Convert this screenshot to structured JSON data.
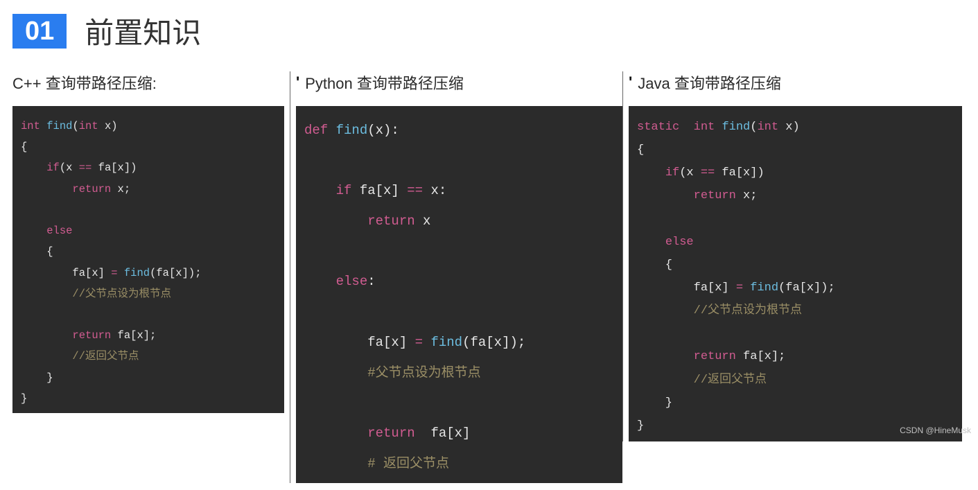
{
  "header": {
    "num": "01",
    "title": "前置知识"
  },
  "columns": [
    {
      "heading": "C++ 查询带路径压缩:",
      "showTick": false,
      "code": [
        {
          "segs": [
            {
              "cls": "c-type",
              "t": "int "
            },
            {
              "cls": "c-fn",
              "t": "find"
            },
            {
              "cls": "c-paren",
              "t": "("
            },
            {
              "cls": "c-type",
              "t": "int"
            },
            {
              "cls": "c-plain",
              "t": " x)"
            }
          ]
        },
        {
          "segs": [
            {
              "cls": "c-plain",
              "t": "{"
            }
          ]
        },
        {
          "segs": [
            {
              "cls": "c-plain",
              "t": "    "
            },
            {
              "cls": "c-kw",
              "t": "if"
            },
            {
              "cls": "c-plain",
              "t": "(x "
            },
            {
              "cls": "c-op",
              "t": "=="
            },
            {
              "cls": "c-plain",
              "t": " fa[x])"
            }
          ]
        },
        {
          "segs": [
            {
              "cls": "c-plain",
              "t": "        "
            },
            {
              "cls": "c-ret",
              "t": "return"
            },
            {
              "cls": "c-plain",
              "t": " x;"
            }
          ]
        },
        {
          "segs": [
            {
              "cls": "c-plain",
              "t": " "
            }
          ]
        },
        {
          "segs": [
            {
              "cls": "c-plain",
              "t": "    "
            },
            {
              "cls": "c-else",
              "t": "else"
            }
          ]
        },
        {
          "segs": [
            {
              "cls": "c-plain",
              "t": "    {"
            }
          ]
        },
        {
          "segs": [
            {
              "cls": "c-plain",
              "t": "        fa[x] "
            },
            {
              "cls": "c-op",
              "t": "="
            },
            {
              "cls": "c-plain",
              "t": " "
            },
            {
              "cls": "c-fn",
              "t": "find"
            },
            {
              "cls": "c-plain",
              "t": "(fa[x]);"
            }
          ]
        },
        {
          "segs": [
            {
              "cls": "c-plain",
              "t": "        "
            },
            {
              "cls": "c-comment",
              "t": "//父节点设为根节点"
            }
          ]
        },
        {
          "segs": [
            {
              "cls": "c-plain",
              "t": " "
            }
          ]
        },
        {
          "segs": [
            {
              "cls": "c-plain",
              "t": "        "
            },
            {
              "cls": "c-ret",
              "t": "return"
            },
            {
              "cls": "c-plain",
              "t": " fa[x];"
            }
          ]
        },
        {
          "segs": [
            {
              "cls": "c-plain",
              "t": "        "
            },
            {
              "cls": "c-comment",
              "t": "//返回父节点"
            }
          ]
        },
        {
          "segs": [
            {
              "cls": "c-plain",
              "t": "    }"
            }
          ]
        },
        {
          "segs": [
            {
              "cls": "c-plain",
              "t": "}"
            }
          ]
        }
      ]
    },
    {
      "heading": "Python 查询带路径压缩",
      "showTick": true,
      "code": [
        {
          "segs": [
            {
              "cls": "c-kw",
              "t": "def "
            },
            {
              "cls": "c-fn",
              "t": "find"
            },
            {
              "cls": "c-plain",
              "t": "(x):"
            }
          ]
        },
        {
          "segs": [
            {
              "cls": "c-plain",
              "t": " "
            }
          ]
        },
        {
          "segs": [
            {
              "cls": "c-plain",
              "t": "    "
            },
            {
              "cls": "c-kw",
              "t": "if"
            },
            {
              "cls": "c-plain",
              "t": " fa[x] "
            },
            {
              "cls": "c-op",
              "t": "=="
            },
            {
              "cls": "c-plain",
              "t": " x:"
            }
          ]
        },
        {
          "segs": [
            {
              "cls": "c-plain",
              "t": "        "
            },
            {
              "cls": "c-ret",
              "t": "return"
            },
            {
              "cls": "c-plain",
              "t": " x"
            }
          ]
        },
        {
          "segs": [
            {
              "cls": "c-plain",
              "t": " "
            }
          ]
        },
        {
          "segs": [
            {
              "cls": "c-plain",
              "t": "    "
            },
            {
              "cls": "c-else",
              "t": "else"
            },
            {
              "cls": "c-plain",
              "t": ":"
            }
          ]
        },
        {
          "segs": [
            {
              "cls": "c-plain",
              "t": " "
            }
          ]
        },
        {
          "segs": [
            {
              "cls": "c-plain",
              "t": "        fa[x] "
            },
            {
              "cls": "c-op",
              "t": "="
            },
            {
              "cls": "c-plain",
              "t": " "
            },
            {
              "cls": "c-fn",
              "t": "find"
            },
            {
              "cls": "c-plain",
              "t": "(fa[x]);"
            }
          ]
        },
        {
          "segs": [
            {
              "cls": "c-plain",
              "t": "        "
            },
            {
              "cls": "c-comment",
              "t": "#父节点设为根节点"
            }
          ]
        },
        {
          "segs": [
            {
              "cls": "c-plain",
              "t": " "
            }
          ]
        },
        {
          "segs": [
            {
              "cls": "c-plain",
              "t": "        "
            },
            {
              "cls": "c-ret",
              "t": "return"
            },
            {
              "cls": "c-plain",
              "t": "  fa[x]"
            }
          ]
        },
        {
          "segs": [
            {
              "cls": "c-plain",
              "t": "        "
            },
            {
              "cls": "c-comment",
              "t": "# 返回父节点"
            }
          ]
        }
      ]
    },
    {
      "heading": "Java 查询带路径压缩",
      "showTick": true,
      "code": [
        {
          "segs": [
            {
              "cls": "c-static",
              "t": "static"
            },
            {
              "cls": "c-plain",
              "t": "  "
            },
            {
              "cls": "c-type",
              "t": "int"
            },
            {
              "cls": "c-plain",
              "t": " "
            },
            {
              "cls": "c-fn",
              "t": "find"
            },
            {
              "cls": "c-plain",
              "t": "("
            },
            {
              "cls": "c-type",
              "t": "int"
            },
            {
              "cls": "c-plain",
              "t": " x)"
            }
          ]
        },
        {
          "segs": [
            {
              "cls": "c-plain",
              "t": "{"
            }
          ]
        },
        {
          "segs": [
            {
              "cls": "c-plain",
              "t": "    "
            },
            {
              "cls": "c-kw",
              "t": "if"
            },
            {
              "cls": "c-plain",
              "t": "(x "
            },
            {
              "cls": "c-op",
              "t": "=="
            },
            {
              "cls": "c-plain",
              "t": " fa[x])"
            }
          ]
        },
        {
          "segs": [
            {
              "cls": "c-plain",
              "t": "        "
            },
            {
              "cls": "c-ret",
              "t": "return"
            },
            {
              "cls": "c-plain",
              "t": " x;"
            }
          ]
        },
        {
          "segs": [
            {
              "cls": "c-plain",
              "t": " "
            }
          ]
        },
        {
          "segs": [
            {
              "cls": "c-plain",
              "t": "    "
            },
            {
              "cls": "c-else",
              "t": "else"
            }
          ]
        },
        {
          "segs": [
            {
              "cls": "c-plain",
              "t": "    {"
            }
          ]
        },
        {
          "segs": [
            {
              "cls": "c-plain",
              "t": "        fa[x] "
            },
            {
              "cls": "c-op",
              "t": "="
            },
            {
              "cls": "c-plain",
              "t": " "
            },
            {
              "cls": "c-fn",
              "t": "find"
            },
            {
              "cls": "c-plain",
              "t": "(fa[x]);"
            }
          ]
        },
        {
          "segs": [
            {
              "cls": "c-plain",
              "t": "        "
            },
            {
              "cls": "c-comment",
              "t": "//父节点设为根节点"
            }
          ]
        },
        {
          "segs": [
            {
              "cls": "c-plain",
              "t": " "
            }
          ]
        },
        {
          "segs": [
            {
              "cls": "c-plain",
              "t": "        "
            },
            {
              "cls": "c-ret",
              "t": "return"
            },
            {
              "cls": "c-plain",
              "t": " fa[x];"
            }
          ]
        },
        {
          "segs": [
            {
              "cls": "c-plain",
              "t": "        "
            },
            {
              "cls": "c-comment",
              "t": "//返回父节点"
            }
          ]
        },
        {
          "segs": [
            {
              "cls": "c-plain",
              "t": "    }"
            }
          ]
        },
        {
          "segs": [
            {
              "cls": "c-plain",
              "t": "}"
            }
          ]
        }
      ]
    }
  ],
  "watermark": "CSDN @HineMusk"
}
